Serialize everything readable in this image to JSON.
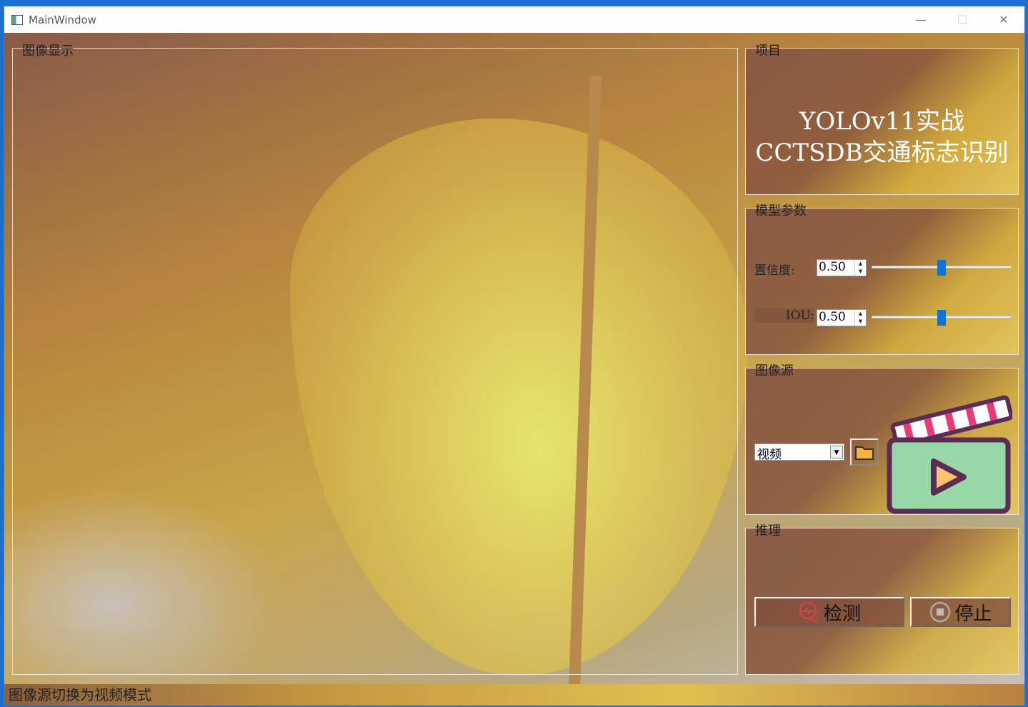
{
  "window": {
    "title": "MainWindow",
    "minimize": "—",
    "maximize": "☐",
    "close": "✕"
  },
  "display": {
    "label": "图像显示"
  },
  "project": {
    "label": "项目",
    "title_line1": "YOLOv11实战",
    "title_line2": "CCTSDB交通标志识别"
  },
  "params": {
    "label": "模型参数",
    "confidence_label": "置信度:",
    "confidence_value": "0.50",
    "confidence_fraction": 0.5,
    "iou_label": "IOU:",
    "iou_value": "0.50",
    "iou_fraction": 0.5
  },
  "source": {
    "label": "图像源",
    "selected": "视频",
    "folder_icon": "folder-icon",
    "media_icon": "clapperboard-play-icon"
  },
  "inference": {
    "label": "推理",
    "detect_label": "检测",
    "stop_label": "停止"
  },
  "status": {
    "text": "图像源切换为视频模式"
  }
}
